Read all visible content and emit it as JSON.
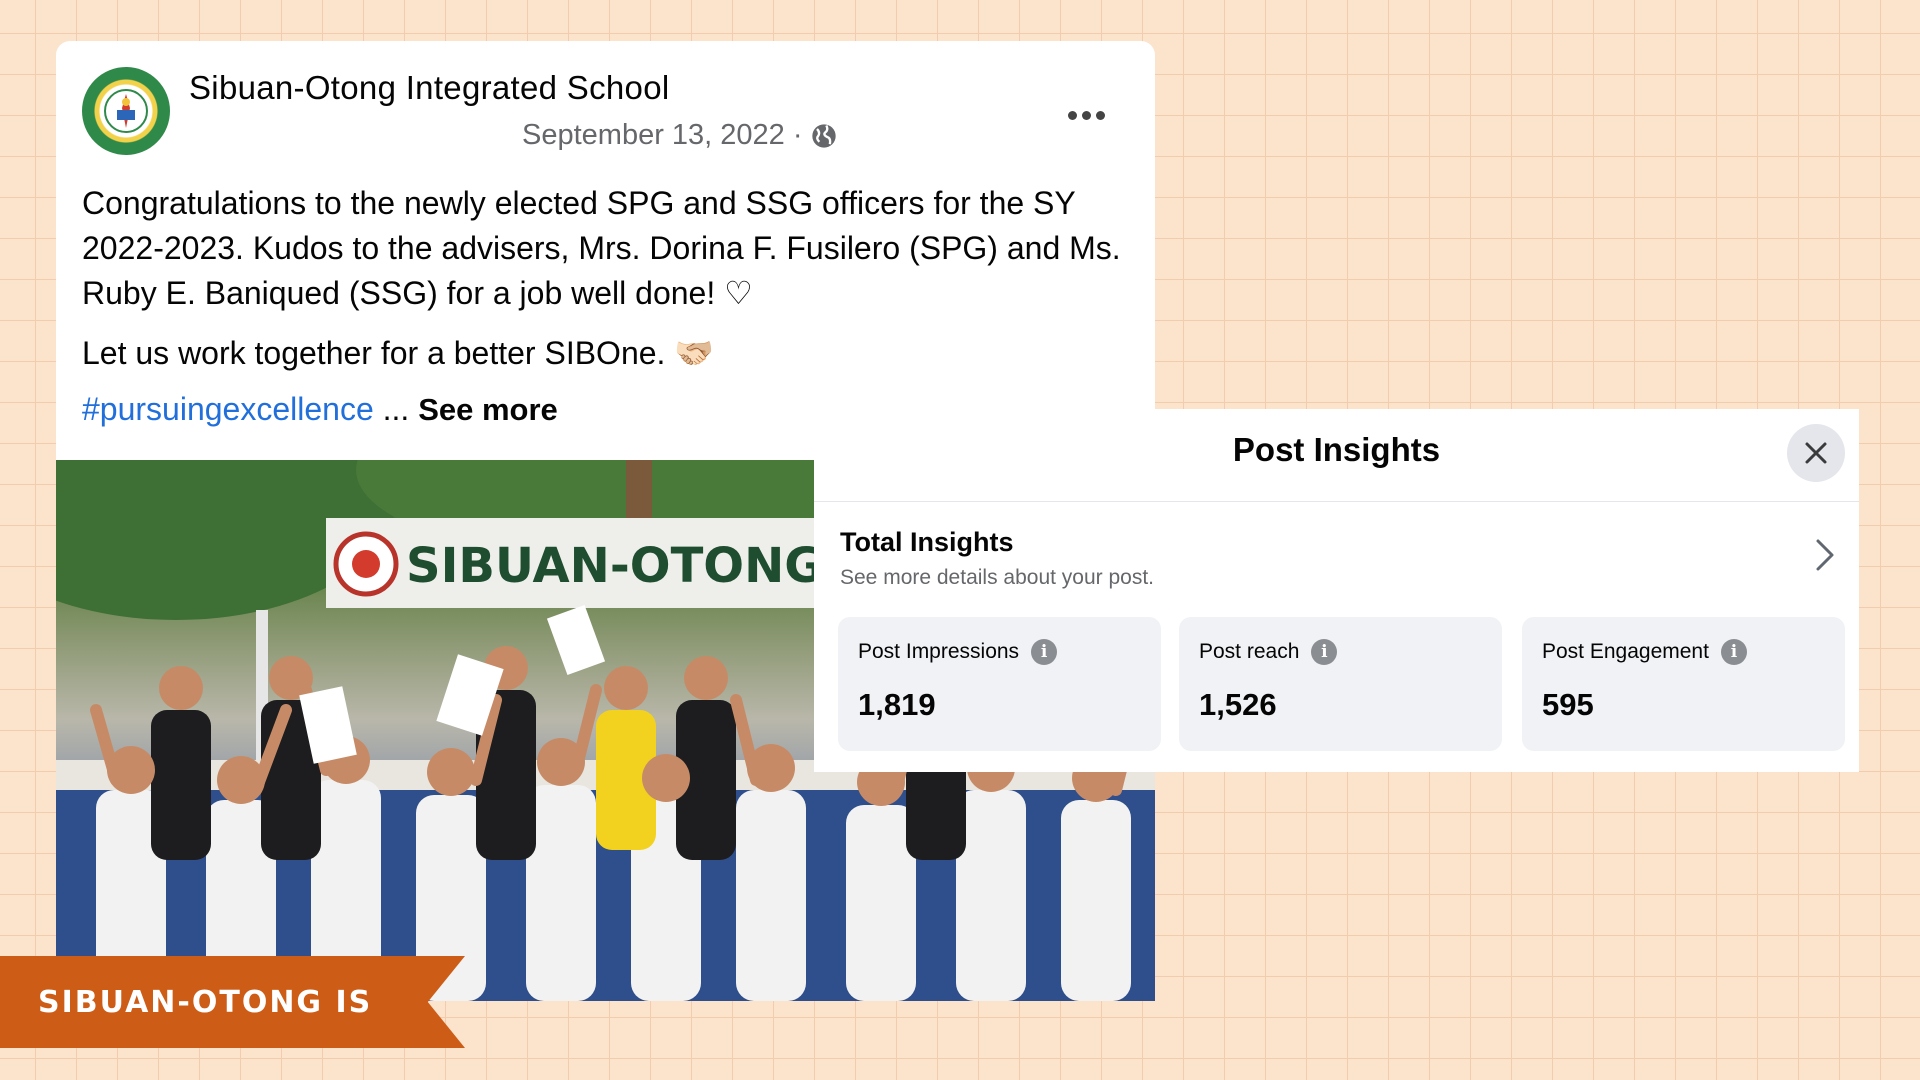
{
  "post": {
    "page_name": "Sibuan-Otong Integrated School",
    "date": "September 13, 2022",
    "separator": "·",
    "visibility_icon": "globe-icon",
    "paragraphs": [
      "Congratulations to the newly elected SPG and SSG officers for the SY 2022-2023. Kudos to the advisers, Mrs. Dorina F. Fusilero (SPG) and Ms. Ruby E. Baniqued (SSG) for a job well done! ♡",
      "Let us work together for a better SIBOne. 🫱🏻‍🫲🏼"
    ],
    "hashtag": "#pursuingexcellence",
    "ellipsis": " ... ",
    "see_more": "See more",
    "photo_sign_text": "SIBUAN-OTONG INTEGRATE"
  },
  "insights": {
    "title": "Post Insights",
    "total_title": "Total Insights",
    "total_subtitle": "See more details about your post.",
    "stats": [
      {
        "label": "Post Impressions",
        "value": "1,819"
      },
      {
        "label": "Post reach",
        "value": "1,526"
      },
      {
        "label": "Post Engagement",
        "value": "595"
      }
    ],
    "info_glyph": "i"
  },
  "banner": {
    "text": "SIBUAN-OTONG IS"
  },
  "colors": {
    "background": "#fbe3cc",
    "banner": "#cd5d16",
    "hashtag": "#216fdb"
  }
}
